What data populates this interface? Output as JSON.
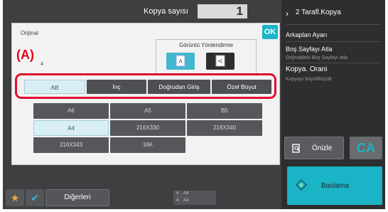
{
  "top_bar": {
    "copy_count_label": "Kopya sayısı",
    "copy_count_value": "1"
  },
  "right_panel": {
    "items": [
      {
        "label": "2 Tarafl.Kopya",
        "sub": ""
      },
      {
        "label": "Arkaplan Ayarı",
        "sub": ""
      },
      {
        "label": "Boş Sayfayı Atla",
        "sub": "Orijinaldeki Boş Sayfayı atla"
      },
      {
        "label": "Kopya. Orani",
        "sub": "Kopyayı büyüt/küçült"
      }
    ],
    "preview_label": "Önizle",
    "ca_label": "CA",
    "start_label": "Baslama"
  },
  "dialog": {
    "title": "Orijinal",
    "ok_label": "OK",
    "orientation_label": "Görüntü Yönlendirme",
    "callout_label": "(A)",
    "callout_sub": "4",
    "tabs": [
      "AB",
      "İnç",
      "Doğrudan Giriş",
      "Özel Boyut"
    ],
    "active_tab": "AB",
    "sizes": [
      "A6",
      "A5",
      "B5",
      "A4",
      "216X330",
      "216X340",
      "216X343",
      "16K"
    ],
    "selected_size": "A4"
  },
  "bottom_bar": {
    "others_label": "Diğerleri",
    "paper_marks": [
      "4",
      "A4",
      "4",
      "A4"
    ]
  },
  "colors": {
    "accent": "#1bb3c6",
    "callout_red": "#e0102e",
    "star": "#f1a63a"
  }
}
